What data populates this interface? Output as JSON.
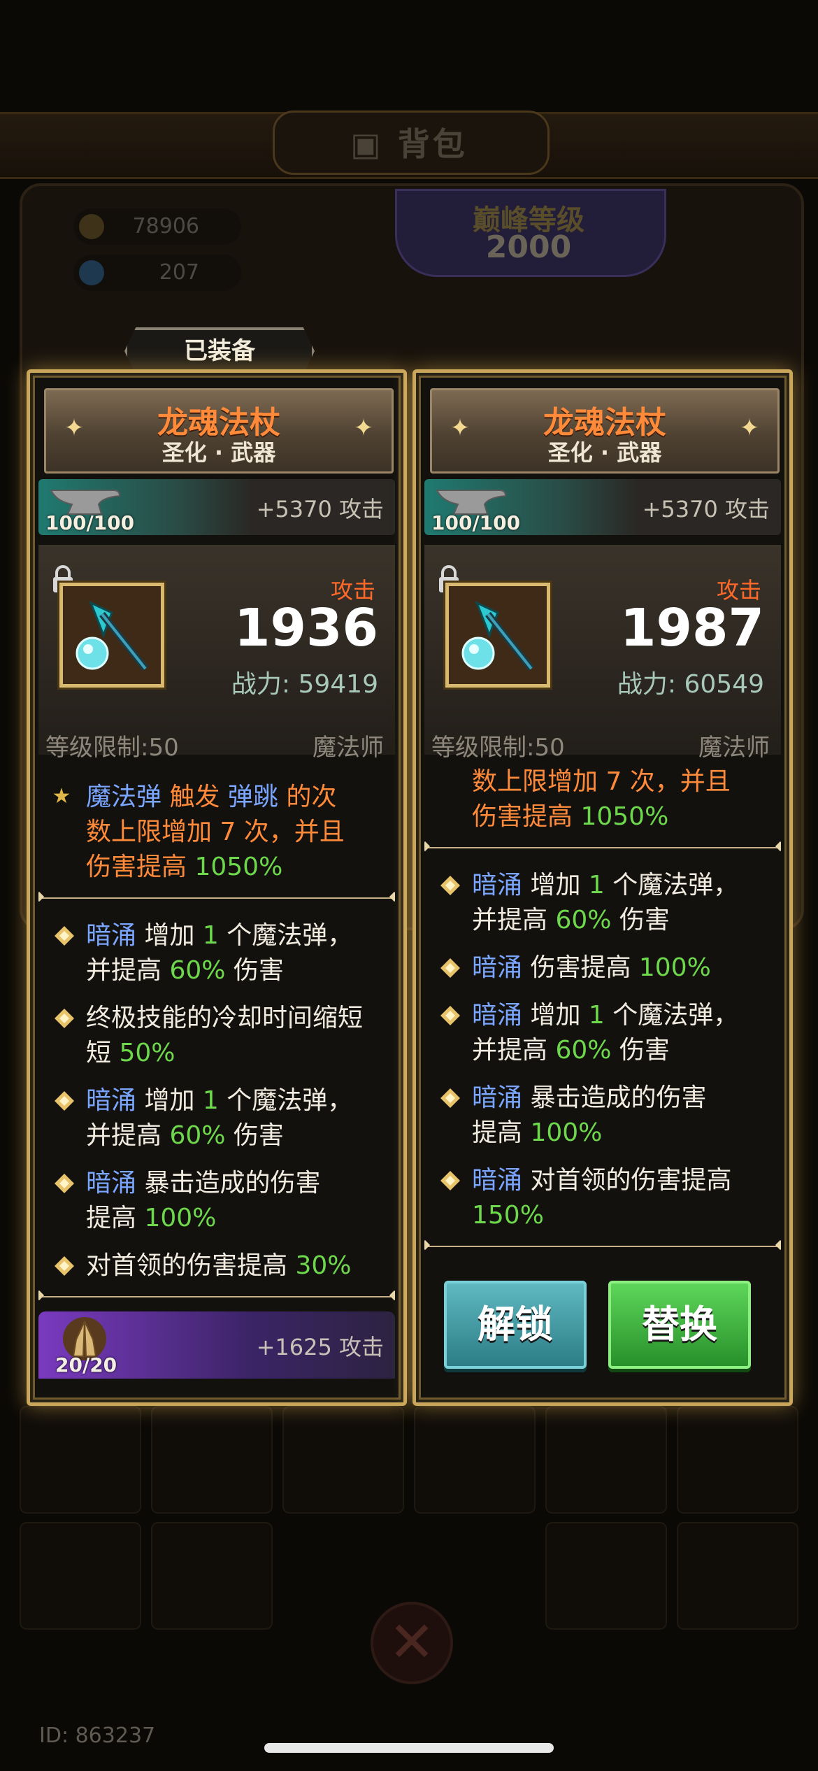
{
  "background": {
    "title": "背包",
    "gold": "78906",
    "gems": "207",
    "peak_label": "巅峰等级",
    "peak_value": "2000",
    "user_id": "ID: 863237"
  },
  "equipped_tab": "已装备",
  "panels": [
    {
      "name": "龙魂法杖",
      "subtitle": "圣化 · 武器",
      "enhance_count": "100/100",
      "enhance_bonus": "+5370 攻击",
      "stat_label": "攻击",
      "stat_value": "1936",
      "power_label": "战力:",
      "power_value": "59419",
      "level_req": "等级限制:50",
      "class": "魔法师",
      "special": {
        "kw1": "魔法弹",
        "w1": " 触发 ",
        "kw2": "弹跳",
        "w2": " 的次",
        "line2": "数上限增加 7 次，并且",
        "line3a": "伤害提高 ",
        "line3b": "1050%"
      },
      "attrs": [
        {
          "kw": "暗涌",
          "t1": " 增加 ",
          "n1": "1",
          "t2": " 个魔法弹，",
          "t3": "并提高 ",
          "n2": "60%",
          "t4": " 伤害"
        },
        {
          "t1": "终极技能的冷却时间缩短",
          "t3": "短 ",
          "n2": "50%"
        },
        {
          "kw": "暗涌",
          "t1": " 增加 ",
          "n1": "1",
          "t2": " 个魔法弹，",
          "t3": "并提高 ",
          "n2": "60%",
          "t4": " 伤害"
        },
        {
          "kw": "暗涌",
          "t1": " 暴击造成的伤害",
          "t3": "提高 ",
          "n2": "100%"
        },
        {
          "t1": "对首领的伤害提高 ",
          "n2": "30%"
        }
      ],
      "purple_count": "20/20",
      "purple_bonus": "+1625 攻击"
    },
    {
      "name": "龙魂法杖",
      "subtitle": "圣化 · 武器",
      "enhance_count": "100/100",
      "enhance_bonus": "+5370 攻击",
      "stat_label": "攻击",
      "stat_value": "1987",
      "power_label": "战力:",
      "power_value": "60549",
      "level_req": "等级限制:50",
      "class": "魔法师",
      "special": {
        "line2": "数上限增加 7 次，并且",
        "line3a": "伤害提高 ",
        "line3b": "1050%"
      },
      "attrs": [
        {
          "kw": "暗涌",
          "t1": " 增加 ",
          "n1": "1",
          "t2": " 个魔法弹，",
          "t3": "并提高 ",
          "n2": "60%",
          "t4": " 伤害"
        },
        {
          "kw": "暗涌",
          "t1": " 伤害提高 ",
          "n2": "100%"
        },
        {
          "kw": "暗涌",
          "t1": " 增加 ",
          "n1": "1",
          "t2": " 个魔法弹，",
          "t3": "并提高 ",
          "n2": "60%",
          "t4": " 伤害"
        },
        {
          "kw": "暗涌",
          "t1": " 暴击造成的伤害",
          "t3": "提高 ",
          "n2": "100%"
        },
        {
          "kw": "暗涌",
          "t1": " 对首领的伤害提高",
          "t3": "",
          "n2": "150%"
        }
      ],
      "buttons": {
        "unlock": "解锁",
        "replace": "替换"
      }
    }
  ]
}
